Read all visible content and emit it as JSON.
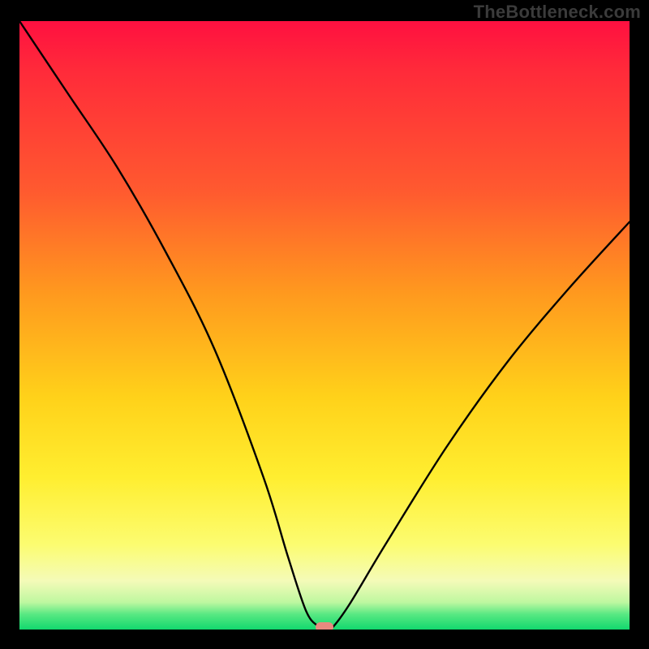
{
  "watermark": "TheBottleneck.com",
  "chart_data": {
    "type": "line",
    "title": "",
    "xlabel": "",
    "ylabel": "",
    "xlim": [
      0,
      100
    ],
    "ylim": [
      0,
      100
    ],
    "grid": false,
    "legend": false,
    "background_gradient": {
      "direction": "vertical",
      "stops": [
        {
          "pos": 0,
          "color": "#ff1040",
          "meaning": "high-bottleneck"
        },
        {
          "pos": 50,
          "color": "#ffc81e"
        },
        {
          "pos": 86,
          "color": "#fcfc70"
        },
        {
          "pos": 100,
          "color": "#12d86e",
          "meaning": "no-bottleneck"
        }
      ]
    },
    "series": [
      {
        "name": "bottleneck-curve",
        "x": [
          0,
          8,
          16,
          24,
          32,
          40,
          44,
          47,
          49,
          50,
          51,
          54,
          60,
          70,
          80,
          90,
          100
        ],
        "values": [
          100,
          88,
          76,
          62,
          46,
          25,
          12,
          3,
          0.5,
          0,
          0,
          4,
          14,
          30,
          44,
          56,
          67
        ]
      }
    ],
    "marker": {
      "x": 50,
      "y": 0,
      "shape": "pill",
      "color": "#e88a7f"
    }
  }
}
